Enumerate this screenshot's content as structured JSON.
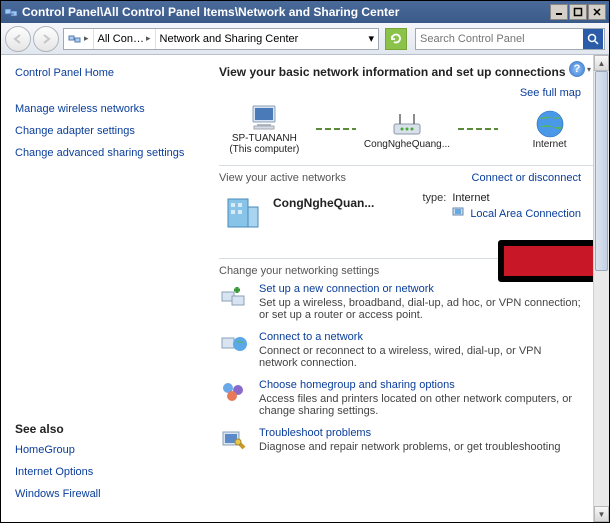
{
  "window": {
    "title": "Control Panel\\All Control Panel Items\\Network and Sharing Center"
  },
  "addressbar": {
    "seg1": "All Con…",
    "seg2": "Network and Sharing Center"
  },
  "search": {
    "placeholder": "Search Control Panel"
  },
  "sidebar": {
    "home": "Control Panel Home",
    "links": [
      "Manage wireless networks",
      "Change adapter settings",
      "Change advanced sharing settings"
    ],
    "seealso_title": "See also",
    "seealso": [
      "HomeGroup",
      "Internet Options",
      "Windows Firewall"
    ]
  },
  "main": {
    "header": "View your basic network information and set up connections",
    "see_full_map": "See full map",
    "nodes": {
      "pc": {
        "line1": "SP-TUANANH",
        "line2": "(This computer)"
      },
      "router": "CongNgheQuang...",
      "internet": "Internet"
    },
    "active_title": "View your active networks",
    "connect_link": "Connect or disconnect",
    "active_net": {
      "name": "CongNgheQuan...",
      "access_type_label": "type:",
      "access_type_value": "Internet",
      "connection_link": "Local Area Connection"
    },
    "change_title": "Change your networking settings",
    "items": [
      {
        "title": "Set up a new connection or network",
        "desc": "Set up a wireless, broadband, dial-up, ad hoc, or VPN connection; or set up a router or access point."
      },
      {
        "title": "Connect to a network",
        "desc": "Connect or reconnect to a wireless, wired, dial-up, or VPN network connection."
      },
      {
        "title": "Choose homegroup and sharing options",
        "desc": "Access files and printers located on other network computers, or change sharing settings."
      },
      {
        "title": "Troubleshoot problems",
        "desc": "Diagnose and repair network problems, or get troubleshooting"
      }
    ]
  }
}
